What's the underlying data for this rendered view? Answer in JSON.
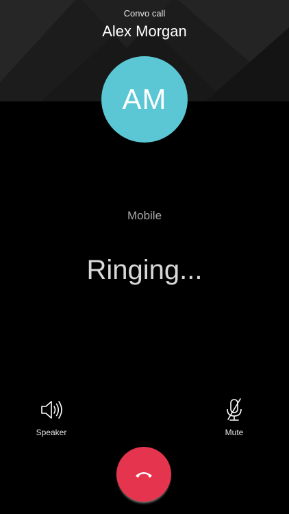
{
  "header": {
    "call_type": "Convo call",
    "contact_name": "Alex Morgan"
  },
  "avatar": {
    "initials": "AM",
    "color": "#5bc7d4"
  },
  "call": {
    "phone_label": "Mobile",
    "status": "Ringing..."
  },
  "controls": {
    "speaker": {
      "label": "Speaker",
      "icon": "speaker-icon"
    },
    "mute": {
      "label": "Mute",
      "icon": "microphone-muted-icon"
    },
    "end_call": {
      "icon": "hang-up-icon",
      "color": "#e5354e"
    }
  }
}
